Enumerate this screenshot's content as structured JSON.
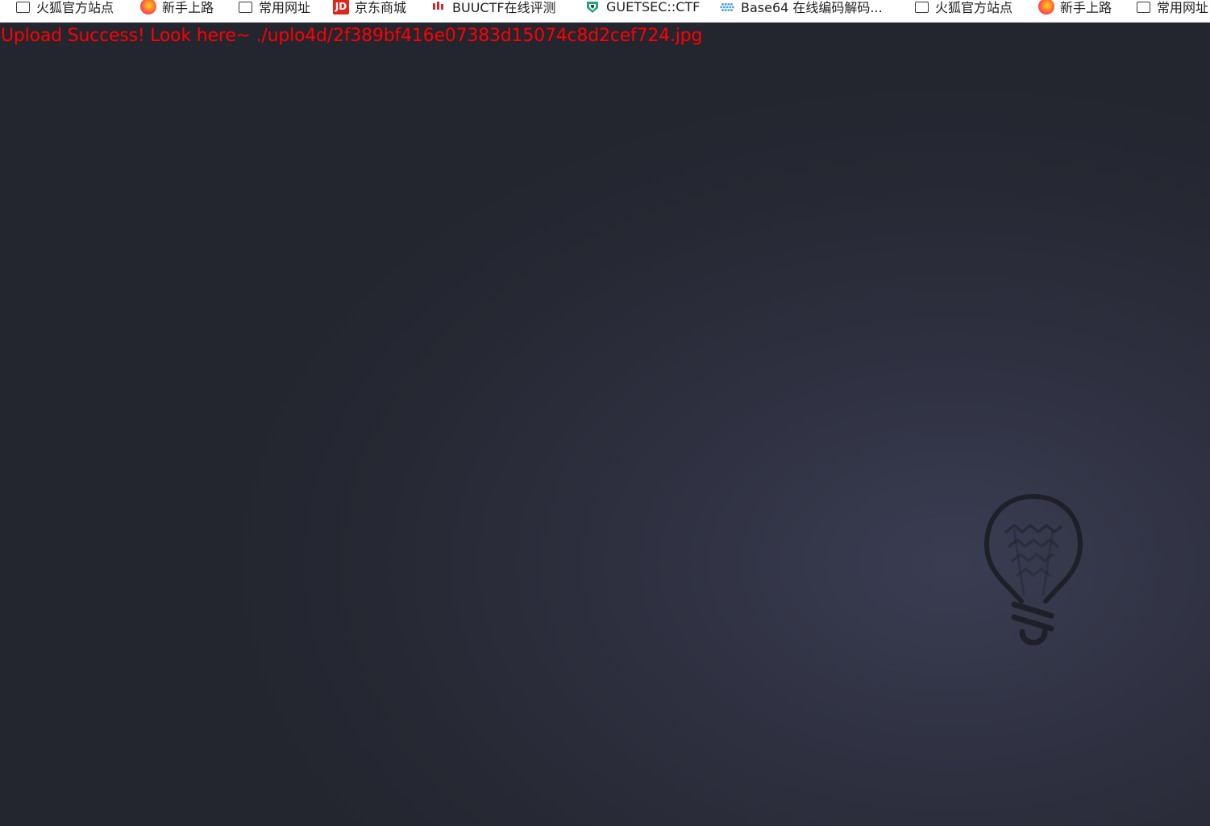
{
  "bookmarks": [
    {
      "label": "火狐官方站点",
      "icon": "folder-icon"
    },
    {
      "label": "新手上路",
      "icon": "firefox-icon"
    },
    {
      "label": "常用网址",
      "icon": "folder-icon"
    },
    {
      "label": "京东商城",
      "icon": "jd-icon",
      "icon_text": "JD"
    },
    {
      "label": "BUUCTF在线评测",
      "icon": "buuctf-icon"
    },
    {
      "label": "GUETSEC::CTF",
      "icon": "guetsec-icon"
    },
    {
      "label": "Base64 在线编码解码...",
      "icon": "base64-icon"
    },
    {
      "label": "火狐官方站点",
      "icon": "folder-icon"
    },
    {
      "label": "新手上路",
      "icon": "firefox-icon"
    },
    {
      "label": "常用网址",
      "icon": "folder-icon"
    }
  ],
  "page": {
    "message": "Upload Success! Look here~ ./uplo4d/2f389bf416e07383d15074c8d2cef724.jpg",
    "message_color": "#ff0000",
    "background_color": "#2b2d3a",
    "decor_icon": "lightbulb-icon"
  }
}
